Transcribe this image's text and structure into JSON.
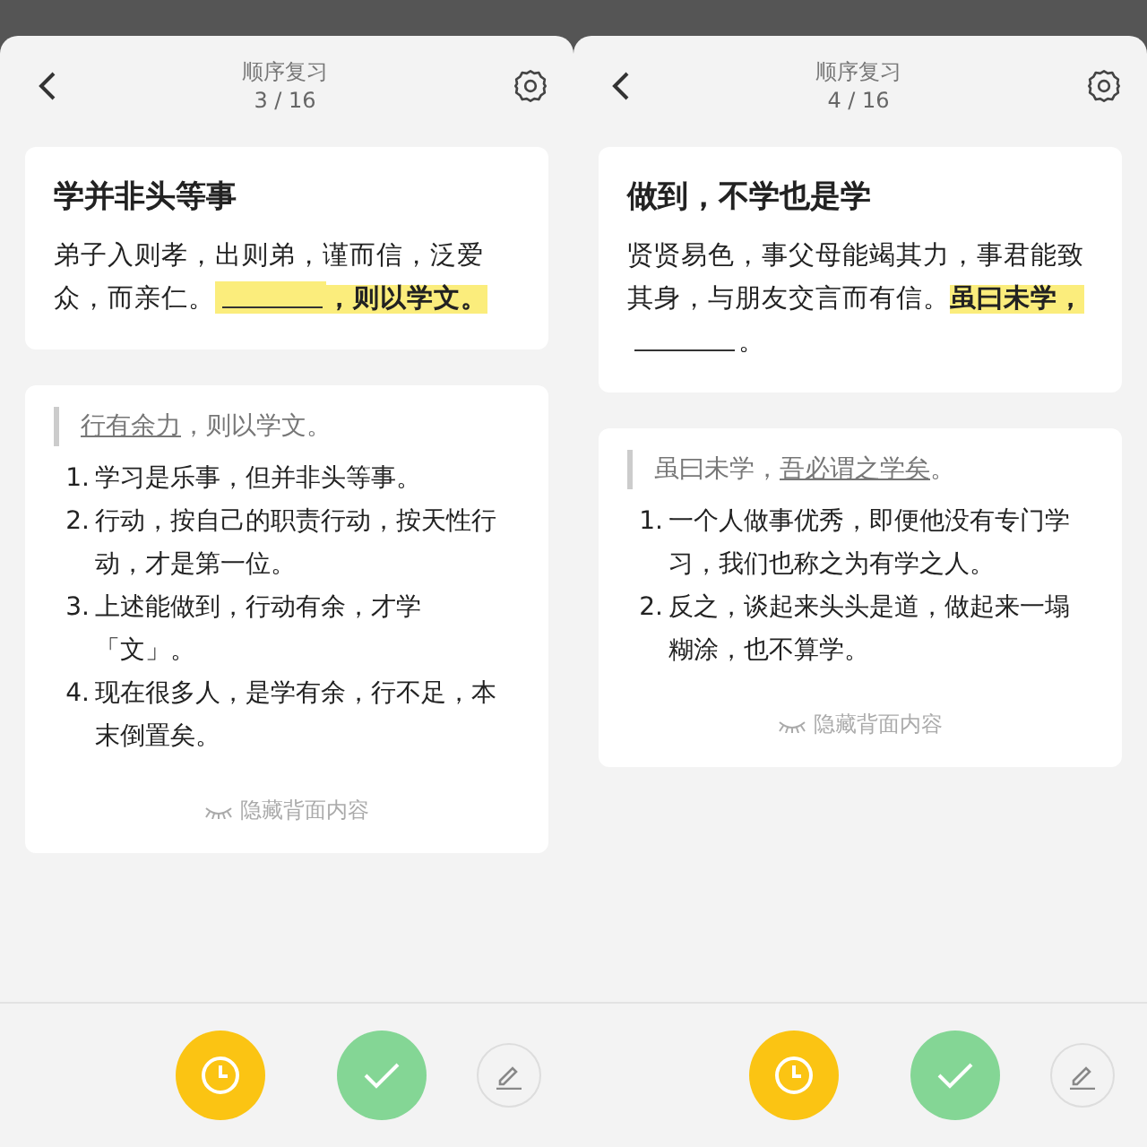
{
  "panels": [
    {
      "header": {
        "title": "顺序复习",
        "counter": "3 / 16"
      },
      "front": {
        "title": "学并非头等事",
        "segments": [
          {
            "kind": "text",
            "text": "弟子入则孝，出则弟，谨而信，泛爱众，而亲仁。",
            "highlight": false
          },
          {
            "kind": "blank",
            "highlight": true
          },
          {
            "kind": "text",
            "text": "，则以学文。",
            "highlight": true
          }
        ]
      },
      "back": {
        "quote": [
          {
            "text": "行有余力",
            "underline": true
          },
          {
            "text": "，则以学文。",
            "underline": false
          }
        ],
        "items": [
          {
            "num": "1.",
            "text": "学习是乐事，但并非头等事。"
          },
          {
            "num": "2.",
            "text": "行动，按自己的职责行动，按天性行动，才是第一位。"
          },
          {
            "num": "3.",
            "text": "上述能做到，行动有余，才学「文」。"
          },
          {
            "num": "4.",
            "text": "现在很多人，是学有余，行不足，本末倒置矣。"
          }
        ],
        "hide_label": "隐藏背面内容"
      }
    },
    {
      "header": {
        "title": "顺序复习",
        "counter": "4 / 16"
      },
      "front": {
        "title": "做到，不学也是学",
        "segments": [
          {
            "kind": "text",
            "text": "贤贤易色，事父母能竭其力，事君能致其身，与朋友交言而有信。",
            "highlight": false
          },
          {
            "kind": "text",
            "text": "虽曰未学，",
            "highlight": true
          },
          {
            "kind": "blank",
            "highlight": false
          },
          {
            "kind": "text",
            "text": "。",
            "highlight": false
          }
        ]
      },
      "back": {
        "quote": [
          {
            "text": "虽曰未学，",
            "underline": false
          },
          {
            "text": "吾必谓之学矣",
            "underline": true
          },
          {
            "text": "。",
            "underline": false
          }
        ],
        "items": [
          {
            "num": "1.",
            "text": "一个人做事优秀，即便他没有专门学习，我们也称之为有学之人。"
          },
          {
            "num": "2.",
            "text": "反之，谈起来头头是道，做起来一塌糊涂，也不算学。"
          }
        ],
        "hide_label": "隐藏背面内容"
      }
    }
  ]
}
